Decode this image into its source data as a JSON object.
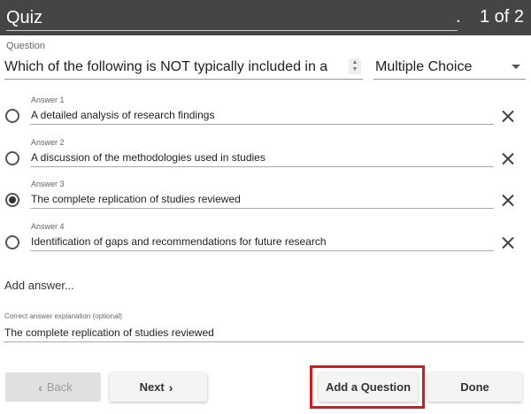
{
  "header": {
    "title": "Quiz",
    "dot": ".",
    "page_counter": "1 of 2"
  },
  "question": {
    "label": "Question",
    "text": "Which of the following is NOT typically included in a",
    "type": "Multiple Choice"
  },
  "answers": [
    {
      "label": "Answer 1",
      "text": "A detailed analysis of research findings",
      "selected": false
    },
    {
      "label": "Answer 2",
      "text": "A discussion of the methodologies used in studies",
      "selected": false
    },
    {
      "label": "Answer 3",
      "text": "The complete replication of studies reviewed",
      "selected": true
    },
    {
      "label": "Answer 4",
      "text": "Identification of gaps and recommendations for future research",
      "selected": false
    }
  ],
  "add_answer_label": "Add answer...",
  "explanation": {
    "label": "Correct answer explanation (optional)",
    "text": "The complete replication of studies reviewed"
  },
  "footer": {
    "back_label": "Back",
    "next_label": "Next",
    "add_question_label": "Add a Question",
    "done_label": "Done"
  },
  "colors": {
    "header_bg": "#454545",
    "highlight": "#d9181e"
  },
  "icons": {
    "remove": "close-icon",
    "back": "chevron-left-icon",
    "next": "chevron-right-icon",
    "dropdown": "caret-down-icon",
    "spinner": "spinner-icon"
  }
}
